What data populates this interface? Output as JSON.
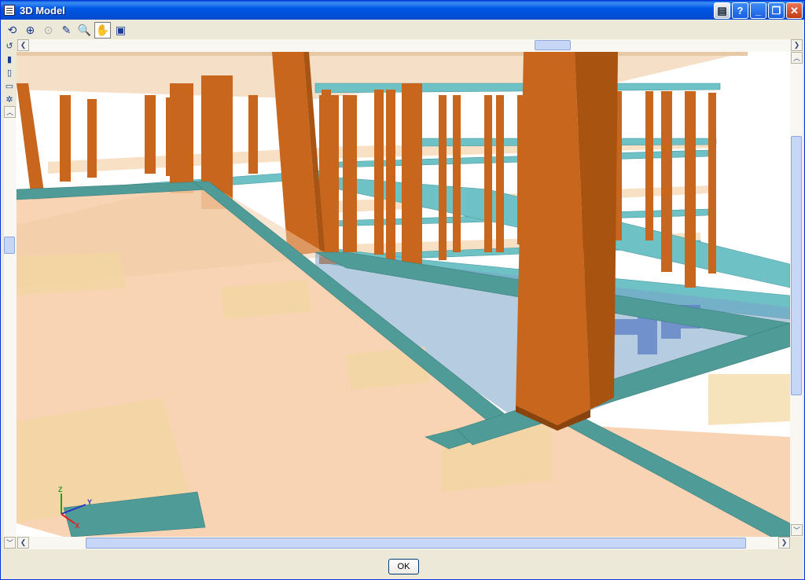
{
  "window": {
    "title": "3D Model"
  },
  "caption_buttons": [
    {
      "name": "book-help-button",
      "icon": "book-icon"
    },
    {
      "name": "help-button",
      "label": "?"
    },
    {
      "name": "minimize-button",
      "label": "_"
    },
    {
      "name": "restore-button",
      "label": "❐"
    },
    {
      "name": "close-button",
      "label": "✕"
    }
  ],
  "toolbar": [
    {
      "name": "rotate-tool",
      "icon": "rotate-icon",
      "glyph": "⟲"
    },
    {
      "name": "zoom-extents-tool",
      "icon": "zoom-extents-icon",
      "glyph": "⊕"
    },
    {
      "name": "zoom-window-tool",
      "icon": "zoom-window-icon",
      "glyph": "⊙",
      "disabled": true
    },
    {
      "name": "pen-tool",
      "icon": "pen-icon",
      "glyph": "✎"
    },
    {
      "name": "zoom-tool",
      "icon": "magnifier-icon",
      "glyph": "🔍"
    },
    {
      "name": "pan-tool",
      "icon": "hand-icon",
      "glyph": "✋",
      "active": true
    },
    {
      "name": "view-options-tool",
      "icon": "view-options-icon",
      "glyph": "▣"
    }
  ],
  "side_tools": [
    {
      "name": "undo-view-tool",
      "icon": "undo-icon",
      "glyph": "↺"
    },
    {
      "name": "color-tool",
      "icon": "color-bars-icon",
      "glyph": "▮"
    },
    {
      "name": "section-tool",
      "icon": "section-icon",
      "glyph": "▯"
    },
    {
      "name": "display-tool",
      "icon": "display-icon",
      "glyph": "▭"
    },
    {
      "name": "settings-tool",
      "icon": "gear-icon",
      "glyph": "✲"
    }
  ],
  "axes": {
    "x": "X",
    "y": "Y",
    "z": "Z",
    "x_color": "#e02020",
    "y_color": "#3030c0",
    "z_color": "#20a020"
  },
  "colors": {
    "column": "#c9661d",
    "beam": "#5fb4b8",
    "slab": "#f5c99a"
  },
  "footer": {
    "ok_label": "OK"
  }
}
